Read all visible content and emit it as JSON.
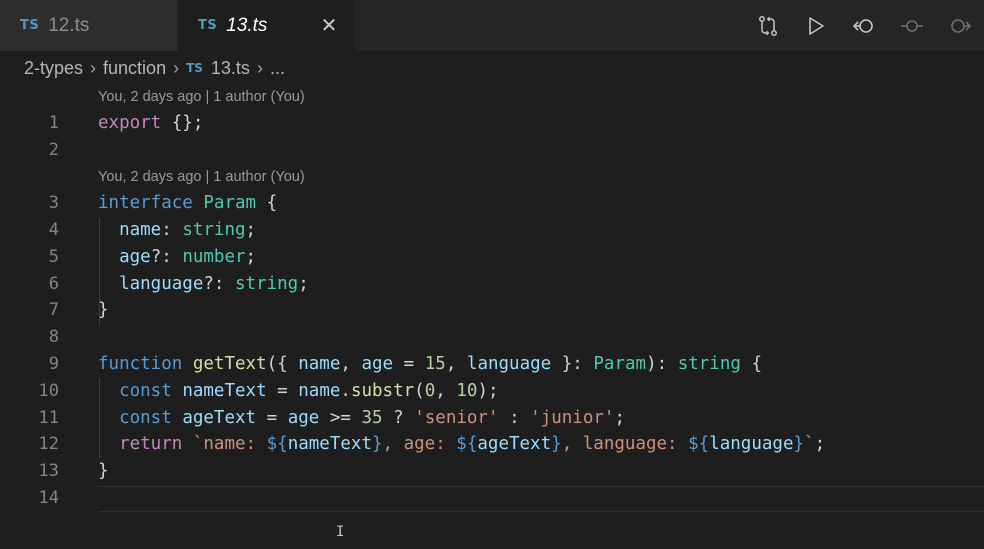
{
  "tabs": [
    {
      "badge": "TS",
      "label": "12.ts",
      "active": false
    },
    {
      "badge": "TS",
      "label": "13.ts",
      "active": true
    }
  ],
  "tab_close_glyph": "✕",
  "actions": [
    "compare-changes-icon",
    "run-icon",
    "go-back-icon",
    "commit-icon",
    "go-forward-icon"
  ],
  "breadcrumb": {
    "items": [
      "2-types",
      "function",
      "13.ts",
      "..."
    ],
    "file_badge": "TS"
  },
  "codelens": [
    "You, 2 days ago | 1 author (You)",
    "You, 2 days ago | 1 author (You)"
  ],
  "lines": [
    {
      "n": "1",
      "code": "export {};"
    },
    {
      "n": "2",
      "code": ""
    },
    {
      "n": "3",
      "code": "interface Param {"
    },
    {
      "n": "4",
      "code": "  name: string;"
    },
    {
      "n": "5",
      "code": "  age?: number;"
    },
    {
      "n": "6",
      "code": "  language?: string;"
    },
    {
      "n": "7",
      "code": "}"
    },
    {
      "n": "8",
      "code": ""
    },
    {
      "n": "9",
      "code": "function getText({ name, age = 15, language }: Param): string {"
    },
    {
      "n": "10",
      "code": "  const nameText = name.substr(0, 10);"
    },
    {
      "n": "11",
      "code": "  const ageText = age >= 35 ? 'senior' : 'junior';"
    },
    {
      "n": "12",
      "code": "  return `name: ${nameText}, age: ${ageText}, language: ${language}`;"
    },
    {
      "n": "13",
      "code": "}"
    },
    {
      "n": "14",
      "code": ""
    }
  ],
  "colors": {
    "keyword": "#569cd6",
    "control": "#c586c0",
    "type": "#4ec9b0",
    "function": "#dcdcaa",
    "variable": "#9cdcfe",
    "number": "#b5cea8",
    "string": "#ce9178",
    "ts_badge": "#519aba"
  }
}
